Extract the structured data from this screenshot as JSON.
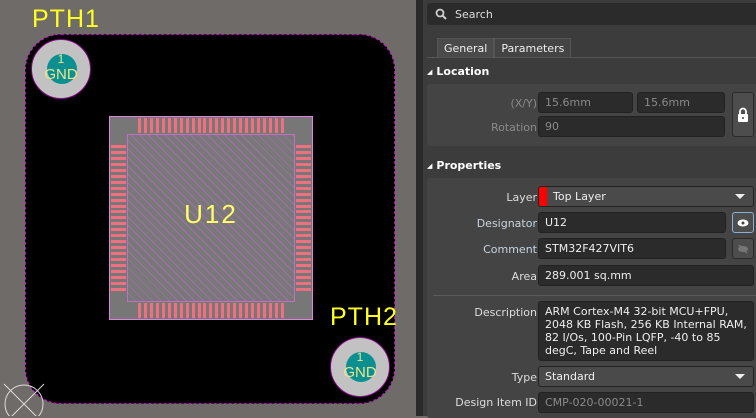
{
  "canvas": {
    "pth1": "PTH1",
    "pth2": "PTH2",
    "pad_number": "1",
    "pad_net": "GND",
    "designator": "U12"
  },
  "panel": {
    "search_placeholder": "Search",
    "tabs": [
      "General",
      "Parameters"
    ],
    "location": {
      "title": "Location",
      "xy_label": "(X/Y)",
      "x": "15.6mm",
      "y": "15.6mm",
      "rotation_label": "Rotation",
      "rotation": "90"
    },
    "properties": {
      "title": "Properties",
      "layer_label": "Layer",
      "layer": "Top Layer",
      "layer_color": "#ff0000",
      "designator_label": "Designator",
      "designator": "U12",
      "comment_label": "Comment",
      "comment": "STM32F427VIT6",
      "area_label": "Area",
      "area": "289.001 sq.mm",
      "description_label": "Description",
      "description": "ARM Cortex-M4 32-bit MCU+FPU, 2048 KB Flash, 256 KB Internal RAM, 82 I/Os, 100-Pin LQFP, -40 to 85 degC, Tape and Reel",
      "type_label": "Type",
      "type": "Standard",
      "design_item_id_label": "Design Item ID",
      "design_item_id": "CMP-020-00021-1"
    }
  }
}
